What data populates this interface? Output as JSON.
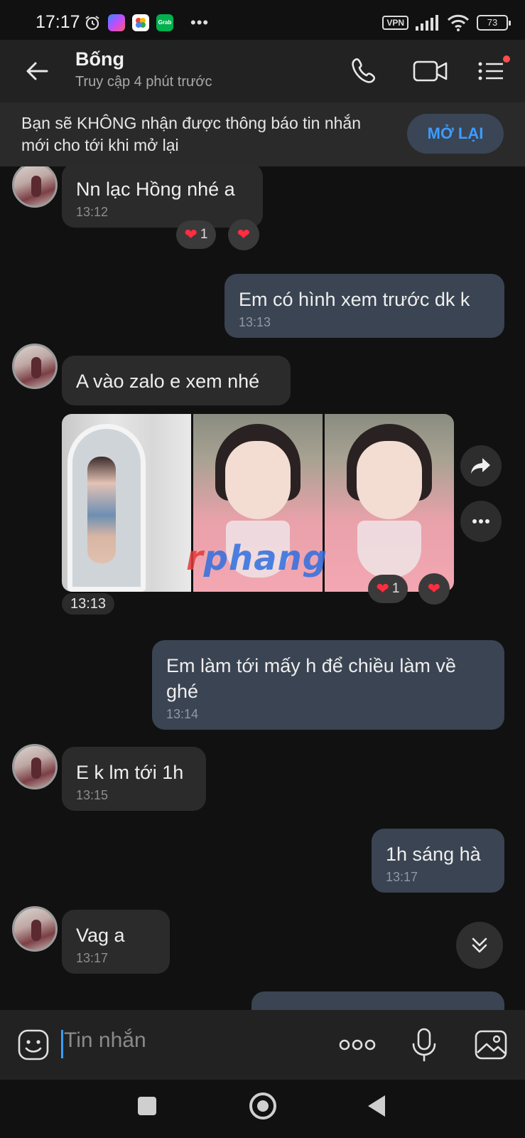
{
  "status_bar": {
    "time": "17:17",
    "vpn_label": "VPN",
    "battery": "73",
    "more_dots": "•••",
    "icons": [
      "alarm-icon",
      "messenger-icon",
      "photos-icon",
      "grab-icon",
      "signal-icon",
      "wifi-icon",
      "battery-icon"
    ]
  },
  "header": {
    "contact_name": "Bống",
    "last_seen": "Truy cập 4 phút trước",
    "actions": [
      "back-icon",
      "phone-icon",
      "video-icon",
      "menu-icon"
    ]
  },
  "notice": {
    "text": "Bạn sẽ KHÔNG nhận được thông báo tin nhắn mới cho tới khi mở lại",
    "button_label": "MỞ LẠI"
  },
  "messages": [
    {
      "direction": "in",
      "text": "Nn lạc Hồng nhé a",
      "time": "13:12",
      "reaction_count": "1"
    },
    {
      "direction": "out",
      "text": "Em có hình xem trước dk k",
      "time": "13:13"
    },
    {
      "direction": "in",
      "text": "A vào zalo e xem nhé",
      "time": ""
    },
    {
      "direction": "in",
      "type": "photos",
      "photo_count": 3,
      "watermark": "phang",
      "time": "13:13",
      "reaction_count": "1"
    },
    {
      "direction": "out",
      "text": "Em làm tới mấy h để chiều làm về ghé",
      "time": "13:14"
    },
    {
      "direction": "in",
      "text": "E k lm tới 1h",
      "time": "13:15"
    },
    {
      "direction": "out",
      "text": "1h sáng hà",
      "time": "13:17"
    },
    {
      "direction": "in",
      "text": "Vag a",
      "time": "13:17"
    }
  ],
  "composer": {
    "placeholder": "Tin nhắn",
    "icons": [
      "sticker-icon",
      "more-icon",
      "microphone-icon",
      "image-icon"
    ]
  },
  "colors": {
    "background": "#111111",
    "header": "#222222",
    "incoming_bubble": "#2b2b2b",
    "outgoing_bubble": "#3a4452",
    "accent": "#3d9cff",
    "heart": "#ff2d3f"
  }
}
